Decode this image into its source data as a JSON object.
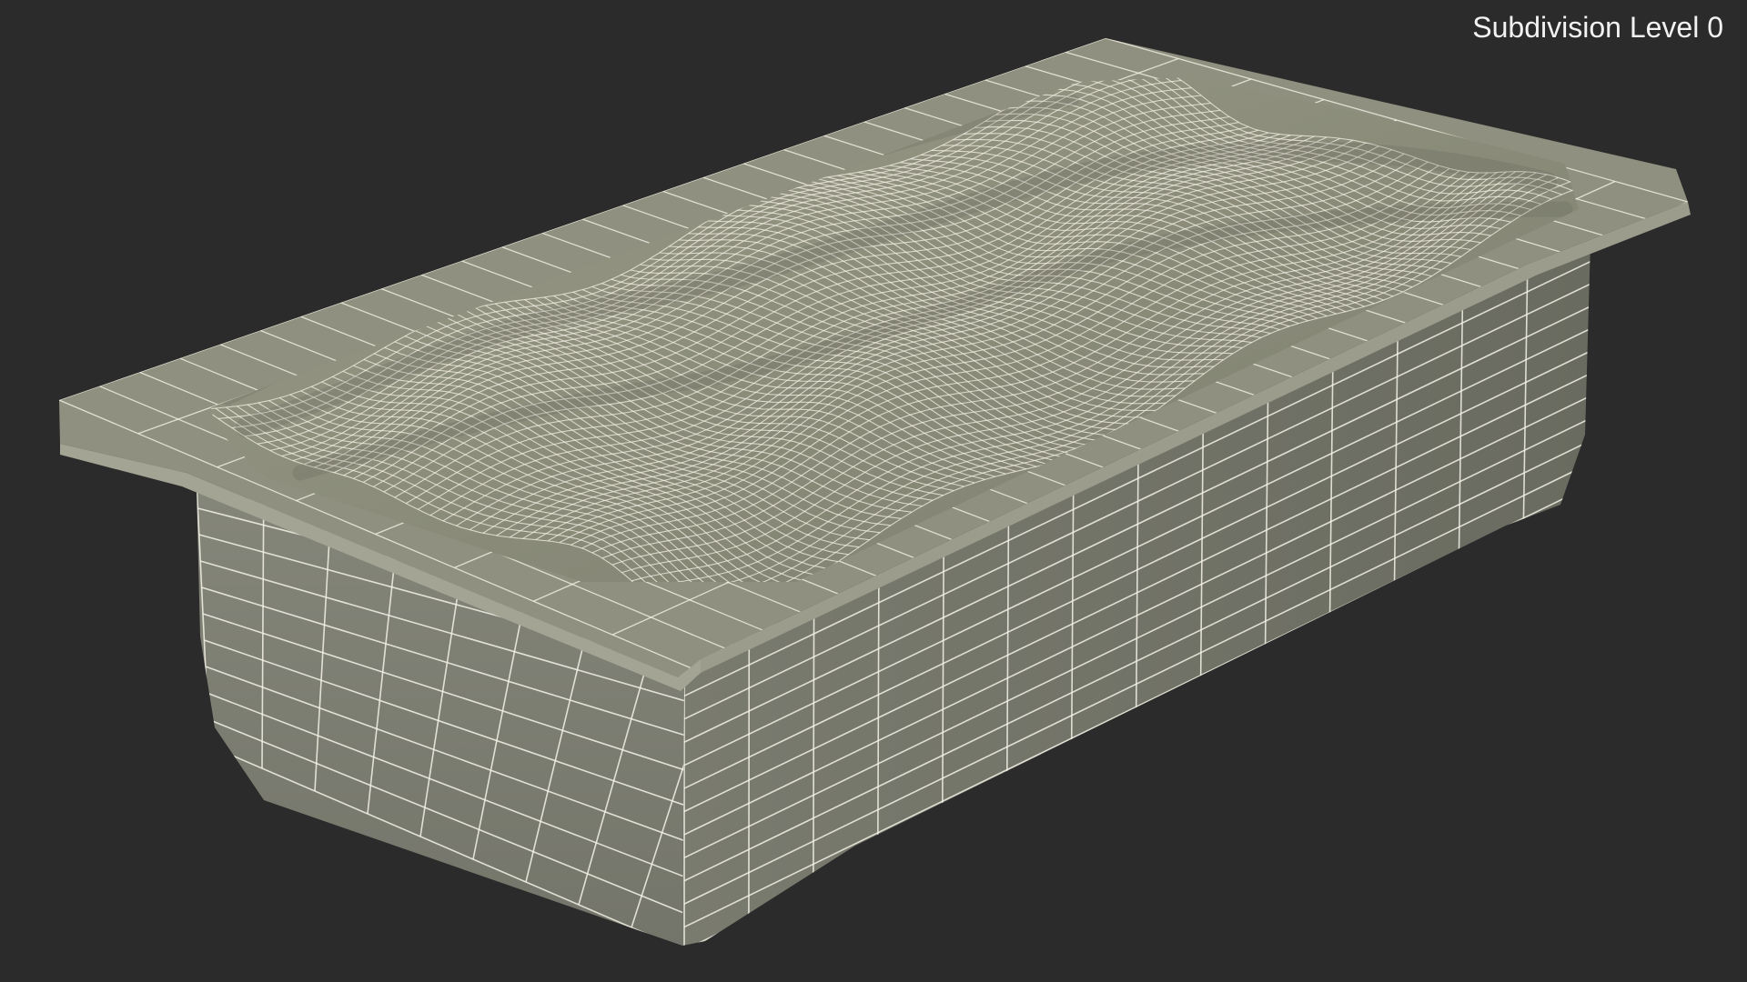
{
  "viewport": {
    "label": "Subdivision Level 0",
    "background_color": "#2b2b2b",
    "wire_color": "#f4f2e6",
    "surface_colors": {
      "rim_top": "#8e8f7e",
      "inner": "#8c8d7b",
      "inner_shade": "#74756a",
      "side_front": "#7b7c6f",
      "side_right": "#6e6f63",
      "rim_edge": "#a1a291"
    },
    "subject_icon": "wireframe-ice-cream-tray-icon"
  }
}
